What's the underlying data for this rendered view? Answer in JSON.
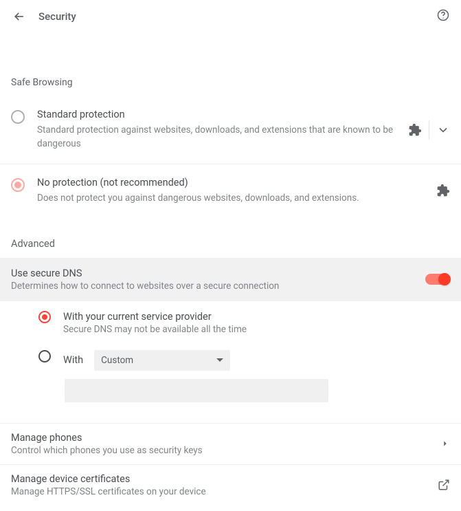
{
  "header": {
    "title": "Security"
  },
  "safe_browsing": {
    "section_label": "Safe Browsing",
    "options": [
      {
        "title": "Standard protection",
        "desc": "Standard protection against websites, downloads, and extensions that are known to be dangerous"
      },
      {
        "title": "No protection (not recommended)",
        "desc": "Does not protect you against dangerous websites, downloads, and extensions."
      }
    ]
  },
  "advanced": {
    "section_label": "Advanced",
    "dns": {
      "title": "Use secure DNS",
      "desc": "Determines how to connect to websites over a secure connection",
      "opt_current": {
        "title": "With your current service provider",
        "desc": "Secure DNS may not be available all the time"
      },
      "opt_with": {
        "label": "With",
        "dropdown": "Custom"
      }
    },
    "manage_phones": {
      "title": "Manage phones",
      "desc": "Control which phones you use as security keys"
    },
    "manage_certs": {
      "title": "Manage device certificates",
      "desc": "Manage HTTPS/SSL certificates on your device"
    }
  }
}
